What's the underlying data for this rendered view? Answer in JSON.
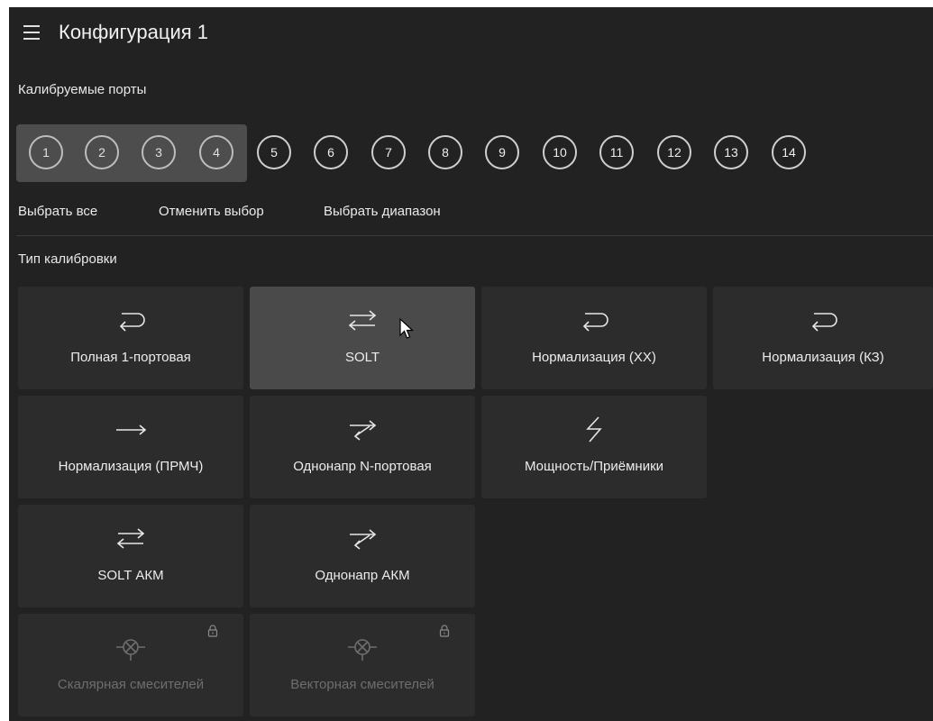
{
  "header": {
    "title": "Конфигурация 1"
  },
  "ports_section": {
    "title": "Калибруемые порты",
    "ports": [
      {
        "label": "1",
        "selected": true
      },
      {
        "label": "2",
        "selected": true
      },
      {
        "label": "3",
        "selected": true
      },
      {
        "label": "4",
        "selected": true
      },
      {
        "label": "5",
        "selected": false
      },
      {
        "label": "6",
        "selected": false
      },
      {
        "label": "7",
        "selected": false
      },
      {
        "label": "8",
        "selected": false
      },
      {
        "label": "9",
        "selected": false
      },
      {
        "label": "10",
        "selected": false
      },
      {
        "label": "11",
        "selected": false
      },
      {
        "label": "12",
        "selected": false
      },
      {
        "label": "13",
        "selected": false
      },
      {
        "label": "14",
        "selected": false
      }
    ],
    "actions": {
      "select_all": "Выбрать все",
      "deselect": "Отменить выбор",
      "select_range": "Выбрать диапазон"
    }
  },
  "calibration_section": {
    "title": "Тип калибровки",
    "types": [
      {
        "label": "Полная 1-портовая",
        "icon": "return-arrow-icon",
        "state": "normal"
      },
      {
        "label": "SOLT",
        "icon": "bidirectional-arrows-icon",
        "state": "selected"
      },
      {
        "label": "Нормализация (XX)",
        "icon": "return-arrow-icon",
        "state": "normal"
      },
      {
        "label": "Нормализация (КЗ)",
        "icon": "return-arrow-icon",
        "state": "normal"
      },
      {
        "label": "Нормализация (ПРМЧ)",
        "icon": "right-arrow-icon",
        "state": "normal"
      },
      {
        "label": "Однонапр N-портовая",
        "icon": "one-way-arrows-icon",
        "state": "normal"
      },
      {
        "label": "Мощность/Приёмники",
        "icon": "lightning-icon",
        "state": "normal"
      },
      {
        "label": "SOLT АКМ",
        "icon": "bidirectional-arrows-icon",
        "state": "normal"
      },
      {
        "label": "Однонапр АКМ",
        "icon": "one-way-arrows-icon",
        "state": "normal"
      },
      {
        "label": "Скалярная смесителей",
        "icon": "mixer-icon",
        "state": "disabled"
      },
      {
        "label": "Векторная смесителей",
        "icon": "mixer-icon",
        "state": "disabled"
      }
    ]
  },
  "colors": {
    "background": "#222222",
    "tile": "#2c2c2c",
    "tile_selected": "#4a4a4a",
    "ports_selected_group": "#4d4d4d",
    "text": "#ececec",
    "text_disabled": "#6e6e6e"
  }
}
